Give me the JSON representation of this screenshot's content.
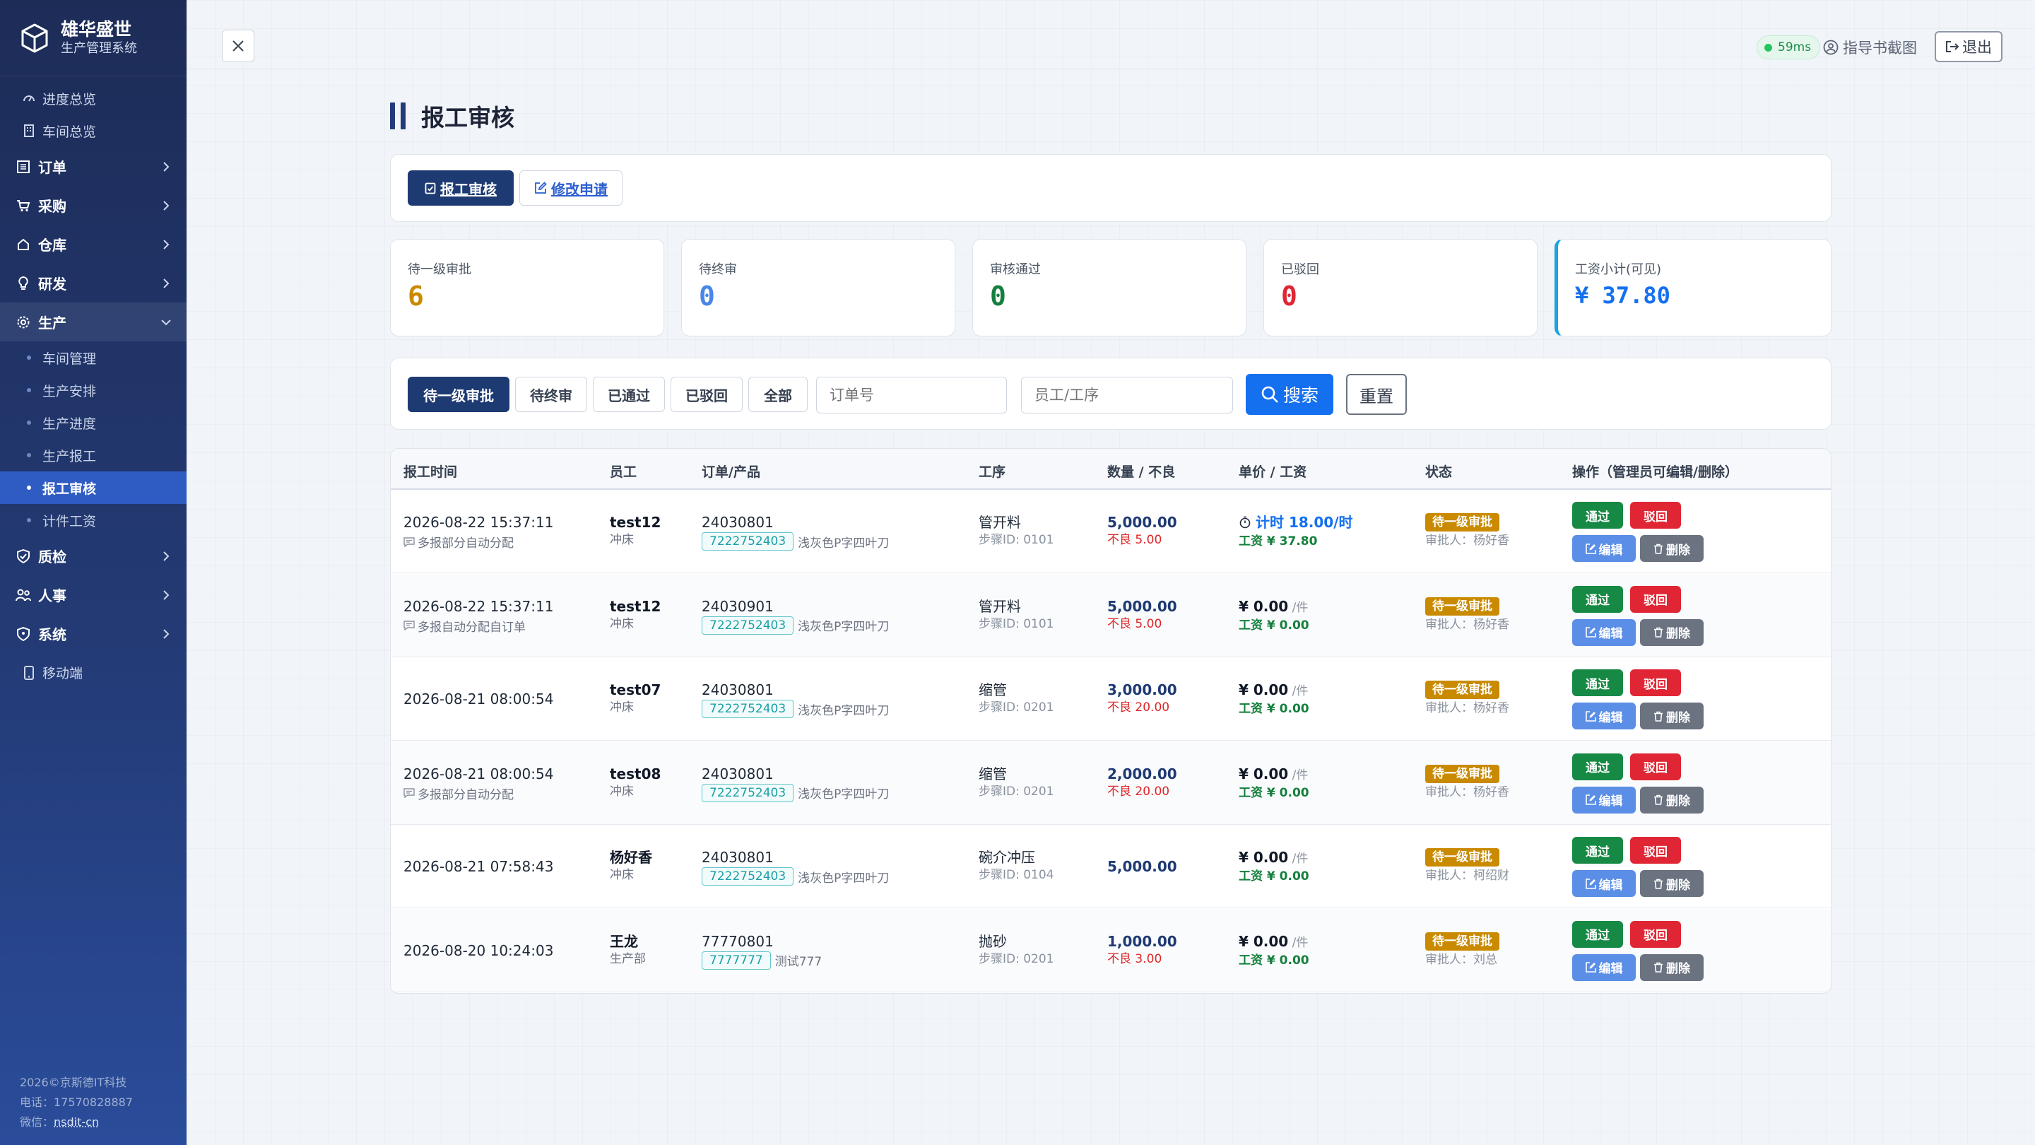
{
  "brand": {
    "title": "雄华盛世",
    "subtitle": "生产管理系统"
  },
  "sidebar": {
    "top_links": [
      {
        "label": "进度总览",
        "icon": "dashboard-icon"
      },
      {
        "label": "车间总览",
        "icon": "building-icon"
      }
    ],
    "groups": [
      {
        "label": "订单",
        "icon": "list-icon"
      },
      {
        "label": "采购",
        "icon": "cart-icon"
      },
      {
        "label": "仓库",
        "icon": "home-icon"
      },
      {
        "label": "研发",
        "icon": "bulb-icon"
      },
      {
        "label": "生产",
        "icon": "gear-icon",
        "open": true
      }
    ],
    "production_items": [
      {
        "label": "车间管理"
      },
      {
        "label": "生产安排"
      },
      {
        "label": "生产进度"
      },
      {
        "label": "生产报工"
      },
      {
        "label": "报工审核",
        "active": true
      },
      {
        "label": "计件工资"
      }
    ],
    "groups2": [
      {
        "label": "质检",
        "icon": "shield-check-icon"
      },
      {
        "label": "人事",
        "icon": "people-icon"
      },
      {
        "label": "系统",
        "icon": "shield-icon"
      }
    ],
    "mobile": "移动端",
    "footer": {
      "copyright": "2026©京斯德IT科技",
      "phone": "电话：17570828887",
      "wechat_label": "微信：",
      "wechat": "nsdit-cn"
    }
  },
  "topbar": {
    "latency": "59ms",
    "guide": "指导书截图",
    "logout": "退出"
  },
  "page": {
    "title": "报工审核"
  },
  "tabs": [
    {
      "label": "报工审核",
      "active": true
    },
    {
      "label": "修改申请"
    }
  ],
  "stats": [
    {
      "label": "待一级审批",
      "value": "6",
      "color": "#c98a00"
    },
    {
      "label": "待终审",
      "value": "0",
      "color": "#4a86e8"
    },
    {
      "label": "审核通过",
      "value": "0",
      "color": "#15803d"
    },
    {
      "label": "已驳回",
      "value": "0",
      "color": "#e02634"
    },
    {
      "label": "工资小计(可见)",
      "value": "¥ 37.80",
      "color": "#1570ef"
    }
  ],
  "filters": {
    "buttons": [
      "待一级审批",
      "待终审",
      "已通过",
      "已驳回",
      "全部"
    ],
    "active": "待一级审批",
    "order_placeholder": "订单号",
    "staff_placeholder": "员工/工序",
    "search": "搜索",
    "reset": "重置"
  },
  "table": {
    "headers": [
      "报工时间",
      "员工",
      "订单/产品",
      "工序",
      "数量 / 不良",
      "单价 / 工资",
      "状态",
      "操作（管理员可编辑/删除）"
    ],
    "actions": {
      "pass": "通过",
      "reject": "驳回",
      "edit": "编辑",
      "delete": "删除"
    },
    "rows": [
      {
        "time": "2026-08-22 15:37:11",
        "note": "多报部分自动分配",
        "employee": "test12",
        "dept": "冲床",
        "order": "24030801",
        "code": "7222752403",
        "product": "浅灰色P字四叶刀",
        "process": "管开料",
        "step": "步骤ID: 0101",
        "qty": "5,000.00",
        "bad": "不良 5.00",
        "price": "计时 18.00/时",
        "price_unit": "",
        "timed": true,
        "wage": "工资 ¥ 37.80",
        "status": "待一级审批",
        "approver": "审批人：杨好香"
      },
      {
        "time": "2026-08-22 15:37:11",
        "note": "多报自动分配自订单",
        "employee": "test12",
        "dept": "冲床",
        "order": "24030901",
        "code": "7222752403",
        "product": "浅灰色P字四叶刀",
        "process": "管开料",
        "step": "步骤ID: 0101",
        "qty": "5,000.00",
        "bad": "不良 5.00",
        "price": "¥ 0.00",
        "price_unit": " /件",
        "timed": false,
        "wage": "工资 ¥ 0.00",
        "status": "待一级审批",
        "approver": "审批人：杨好香"
      },
      {
        "time": "2026-08-21 08:00:54",
        "note": "",
        "employee": "test07",
        "dept": "冲床",
        "order": "24030801",
        "code": "7222752403",
        "product": "浅灰色P字四叶刀",
        "process": "缩管",
        "step": "步骤ID: 0201",
        "qty": "3,000.00",
        "bad": "不良 20.00",
        "price": "¥ 0.00",
        "price_unit": " /件",
        "timed": false,
        "wage": "工资 ¥ 0.00",
        "status": "待一级审批",
        "approver": "审批人：杨好香"
      },
      {
        "time": "2026-08-21 08:00:54",
        "note": "多报部分自动分配",
        "employee": "test08",
        "dept": "冲床",
        "order": "24030801",
        "code": "7222752403",
        "product": "浅灰色P字四叶刀",
        "process": "缩管",
        "step": "步骤ID: 0201",
        "qty": "2,000.00",
        "bad": "不良 20.00",
        "price": "¥ 0.00",
        "price_unit": " /件",
        "timed": false,
        "wage": "工资 ¥ 0.00",
        "status": "待一级审批",
        "approver": "审批人：杨好香"
      },
      {
        "time": "2026-08-21 07:58:43",
        "note": "",
        "employee": "杨好香",
        "dept": "冲床",
        "order": "24030801",
        "code": "7222752403",
        "product": "浅灰色P字四叶刀",
        "process": "碗介冲压",
        "step": "步骤ID: 0104",
        "qty": "5,000.00",
        "bad": "",
        "price": "¥ 0.00",
        "price_unit": " /件",
        "timed": false,
        "wage": "工资 ¥ 0.00",
        "status": "待一级审批",
        "approver": "审批人：柯绍财"
      },
      {
        "time": "2026-08-20 10:24:03",
        "note": "",
        "employee": "王龙",
        "dept": "生产部",
        "order": "77770801",
        "code": "7777777",
        "product": "测试777",
        "process": "抛砂",
        "step": "步骤ID: 0201",
        "qty": "1,000.00",
        "bad": "不良 3.00",
        "price": "¥ 0.00",
        "price_unit": " /件",
        "timed": false,
        "wage": "工资 ¥ 0.00",
        "status": "待一级审批",
        "approver": "审批人：刘总"
      }
    ]
  }
}
